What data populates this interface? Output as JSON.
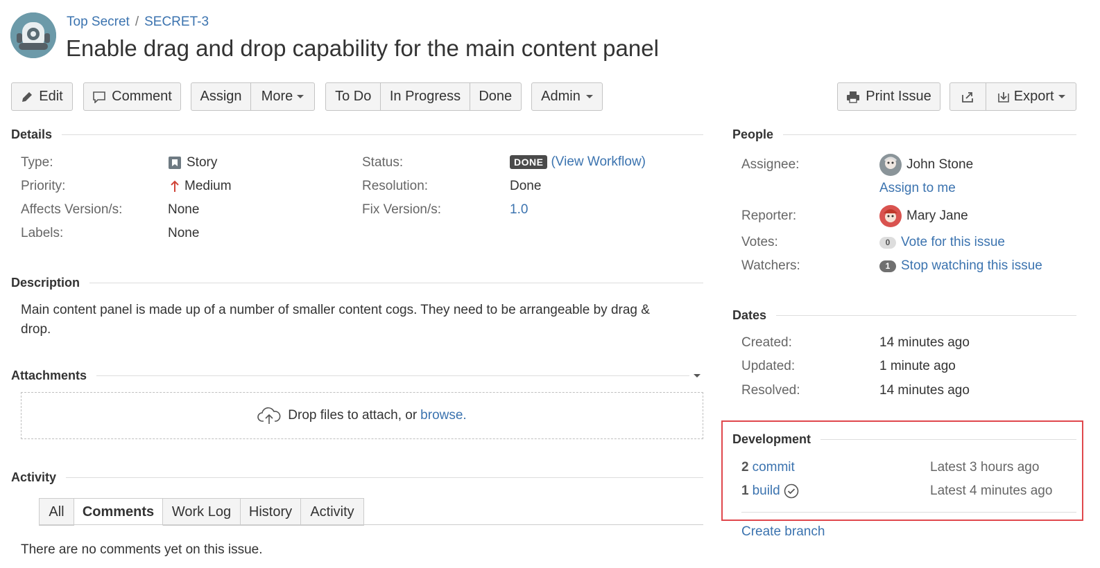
{
  "breadcrumb": {
    "project": "Top Secret",
    "separator": "/",
    "issue_key": "SECRET-3"
  },
  "issue": {
    "title": "Enable drag and drop capability for the main content panel"
  },
  "toolbar": {
    "edit": "Edit",
    "comment": "Comment",
    "assign": "Assign",
    "more": "More",
    "todo": "To Do",
    "in_progress": "In Progress",
    "done": "Done",
    "admin": "Admin",
    "print_issue": "Print Issue",
    "export": "Export"
  },
  "details": {
    "heading": "Details",
    "type_label": "Type:",
    "type_value": "Story",
    "priority_label": "Priority:",
    "priority_value": "Medium",
    "affects_label": "Affects Version/s:",
    "affects_value": "None",
    "labels_label": "Labels:",
    "labels_value": "None",
    "status_label": "Status:",
    "status_value": "DONE",
    "view_workflow": "(View Workflow)",
    "resolution_label": "Resolution:",
    "resolution_value": "Done",
    "fix_label": "Fix Version/s:",
    "fix_value": "1.0"
  },
  "description": {
    "heading": "Description",
    "text_line1": "Main content panel is made up of a number of smaller content cogs. They need to be arrangeable by drag &",
    "text_line2": "drop."
  },
  "attachments": {
    "heading": "Attachments",
    "drop_text": "Drop files to attach, or",
    "browse": "browse."
  },
  "activity": {
    "heading": "Activity",
    "tabs": [
      "All",
      "Comments",
      "Work Log",
      "History",
      "Activity"
    ],
    "active_tab": "Comments",
    "empty_message": "There are no comments yet on this issue."
  },
  "people": {
    "heading": "People",
    "assignee_label": "Assignee:",
    "assignee": "John Stone",
    "assign_to_me": "Assign to me",
    "reporter_label": "Reporter:",
    "reporter": "Mary Jane",
    "votes_label": "Votes:",
    "votes_count": "0",
    "vote_link": "Vote for this issue",
    "watchers_label": "Watchers:",
    "watchers_count": "1",
    "watch_link": "Stop watching this issue"
  },
  "dates": {
    "heading": "Dates",
    "created_label": "Created:",
    "created": "14 minutes ago",
    "updated_label": "Updated:",
    "updated": "1 minute ago",
    "resolved_label": "Resolved:",
    "resolved": "14 minutes ago"
  },
  "development": {
    "heading": "Development",
    "commit_count": "2",
    "commit_label": "commit",
    "commit_latest": "Latest 3 hours ago",
    "build_count": "1",
    "build_label": "build",
    "build_latest": "Latest 4 minutes ago",
    "create_branch": "Create branch"
  },
  "colors": {
    "link": "#3b73af",
    "highlight_border": "#e0474c",
    "done_lozenge": "#4a4a4a",
    "priority_arrow": "#d04437"
  }
}
